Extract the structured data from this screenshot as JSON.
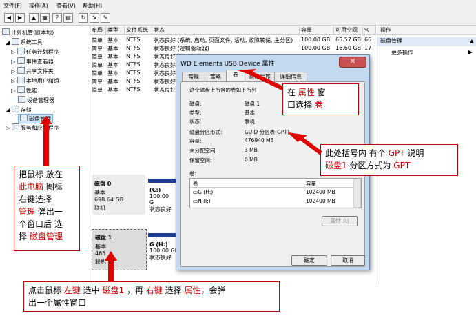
{
  "menubar": {
    "file": "文件(F)",
    "action": "操作(A)",
    "view": "查看(V)",
    "help": "帮助(H)"
  },
  "tree": {
    "root": "计算机管理(本地)",
    "system_tools": "系统工具",
    "task_scheduler": "任务计划程序",
    "event_viewer": "事件查看器",
    "shared_folders": "共享文件夹",
    "local_users": "本地用户和组",
    "performance": "性能",
    "device_manager": "设备管理器",
    "storage": "存储",
    "disk_management": "磁盘管理",
    "services": "服务和应用程序"
  },
  "grid": {
    "headers": [
      "布局",
      "类型",
      "文件系统",
      "状态",
      "容量",
      "可用空间",
      "%"
    ],
    "rows": [
      [
        "简单",
        "基本",
        "NTFS",
        "状态良好 (系统, 启动, 页面文件, 活动, 故障转储, 主分区)",
        "100.00 GB",
        "65.57 GB",
        "66"
      ],
      [
        "简单",
        "基本",
        "NTFS",
        "状态良好 (逻辑驱动器)",
        "100.00 GB",
        "16.60 GB",
        "17"
      ],
      [
        "简单",
        "基本",
        "NTFS",
        "状态良好",
        "",
        "",
        ""
      ],
      [
        "简单",
        "基本",
        "NTFS",
        "状态良好",
        "",
        "",
        ""
      ],
      [
        "简单",
        "基本",
        "NTFS",
        "状态良好",
        "",
        "",
        ""
      ],
      [
        "简单",
        "基本",
        "NTFS",
        "状态良好",
        "",
        "",
        ""
      ],
      [
        "简单",
        "基本",
        "NTFS",
        "状态良好",
        "",
        "",
        ""
      ]
    ]
  },
  "action_pane": {
    "header": "操作",
    "section": "磁盘管理",
    "more": "更多操作"
  },
  "disks": [
    {
      "name": "磁盘 0",
      "type": "基本",
      "size": "698.64 GB",
      "status": "联机",
      "part_name": "(C:)",
      "part_size": "100.00 G",
      "part_status": "状态良好"
    },
    {
      "name": "磁盘 1",
      "type": "基本",
      "size": "465",
      "status": "联机",
      "part_name": "G  (H:)",
      "part_size": "100.00 GB",
      "part_status": "状态良好"
    }
  ],
  "dialog": {
    "title": "WD Elements USB Device 属性",
    "close": "✕",
    "tabs": [
      "常规",
      "策略",
      "卷",
      "驱动程序",
      "详细信息"
    ],
    "intro": "这个磁盘上所含的卷如下所列",
    "props": [
      {
        "label": "磁盘:",
        "value": "磁盘 1"
      },
      {
        "label": "类型:",
        "value": "基本"
      },
      {
        "label": "状态:",
        "value": "联机"
      },
      {
        "label": "磁盘分区形式:",
        "value": "GUID 分区表(GPT)"
      },
      {
        "label": "容量:",
        "value": "476940 MB"
      },
      {
        "label": "未分配空间:",
        "value": "3 MB"
      },
      {
        "label": "保留空间:",
        "value": "0 MB"
      }
    ],
    "volumes_label": "卷:",
    "vol_headers": [
      "卷",
      "容量"
    ],
    "volumes": [
      {
        "name": "G (H:)",
        "size": "102400 MB"
      },
      {
        "name": "N (I:)",
        "size": "102400 MB"
      }
    ],
    "properties_btn": "属性(R)",
    "ok": "确定",
    "cancel": "取消"
  },
  "callouts": {
    "vol_a": "在 ",
    "vol_b": "属性",
    "vol_c": " 窗",
    "vol_d": "口选择 ",
    "vol_e": "卷",
    "gpt_a": "此处括号内 有个 ",
    "gpt_b": "GPT",
    "gpt_c": " 说明",
    "gpt_d": "磁盘1",
    "gpt_e": " 分区方式为 ",
    "gpt_f": "GPT",
    "left_a": "把鼠标 放在",
    "left_b": "此电脑",
    "left_c": " 图标",
    "left_d": "右键选择",
    "left_e": "管理",
    "left_f": " 弹出一",
    "left_g": "个窗口后 选",
    "left_h": "择 ",
    "left_i": "磁盘管理",
    "bottom_a": "点击鼠标 ",
    "bottom_b": "左键",
    "bottom_c": " 选中 ",
    "bottom_d": "磁盘1",
    "bottom_e": " ，再 ",
    "bottom_f": "右键",
    "bottom_g": " 选择 ",
    "bottom_h": "属性",
    "bottom_i": "，会弹",
    "bottom_j": "出一个属性窗口"
  },
  "colors": {
    "accent_red": "#c00000",
    "partition_blue": "#1f3e93"
  }
}
